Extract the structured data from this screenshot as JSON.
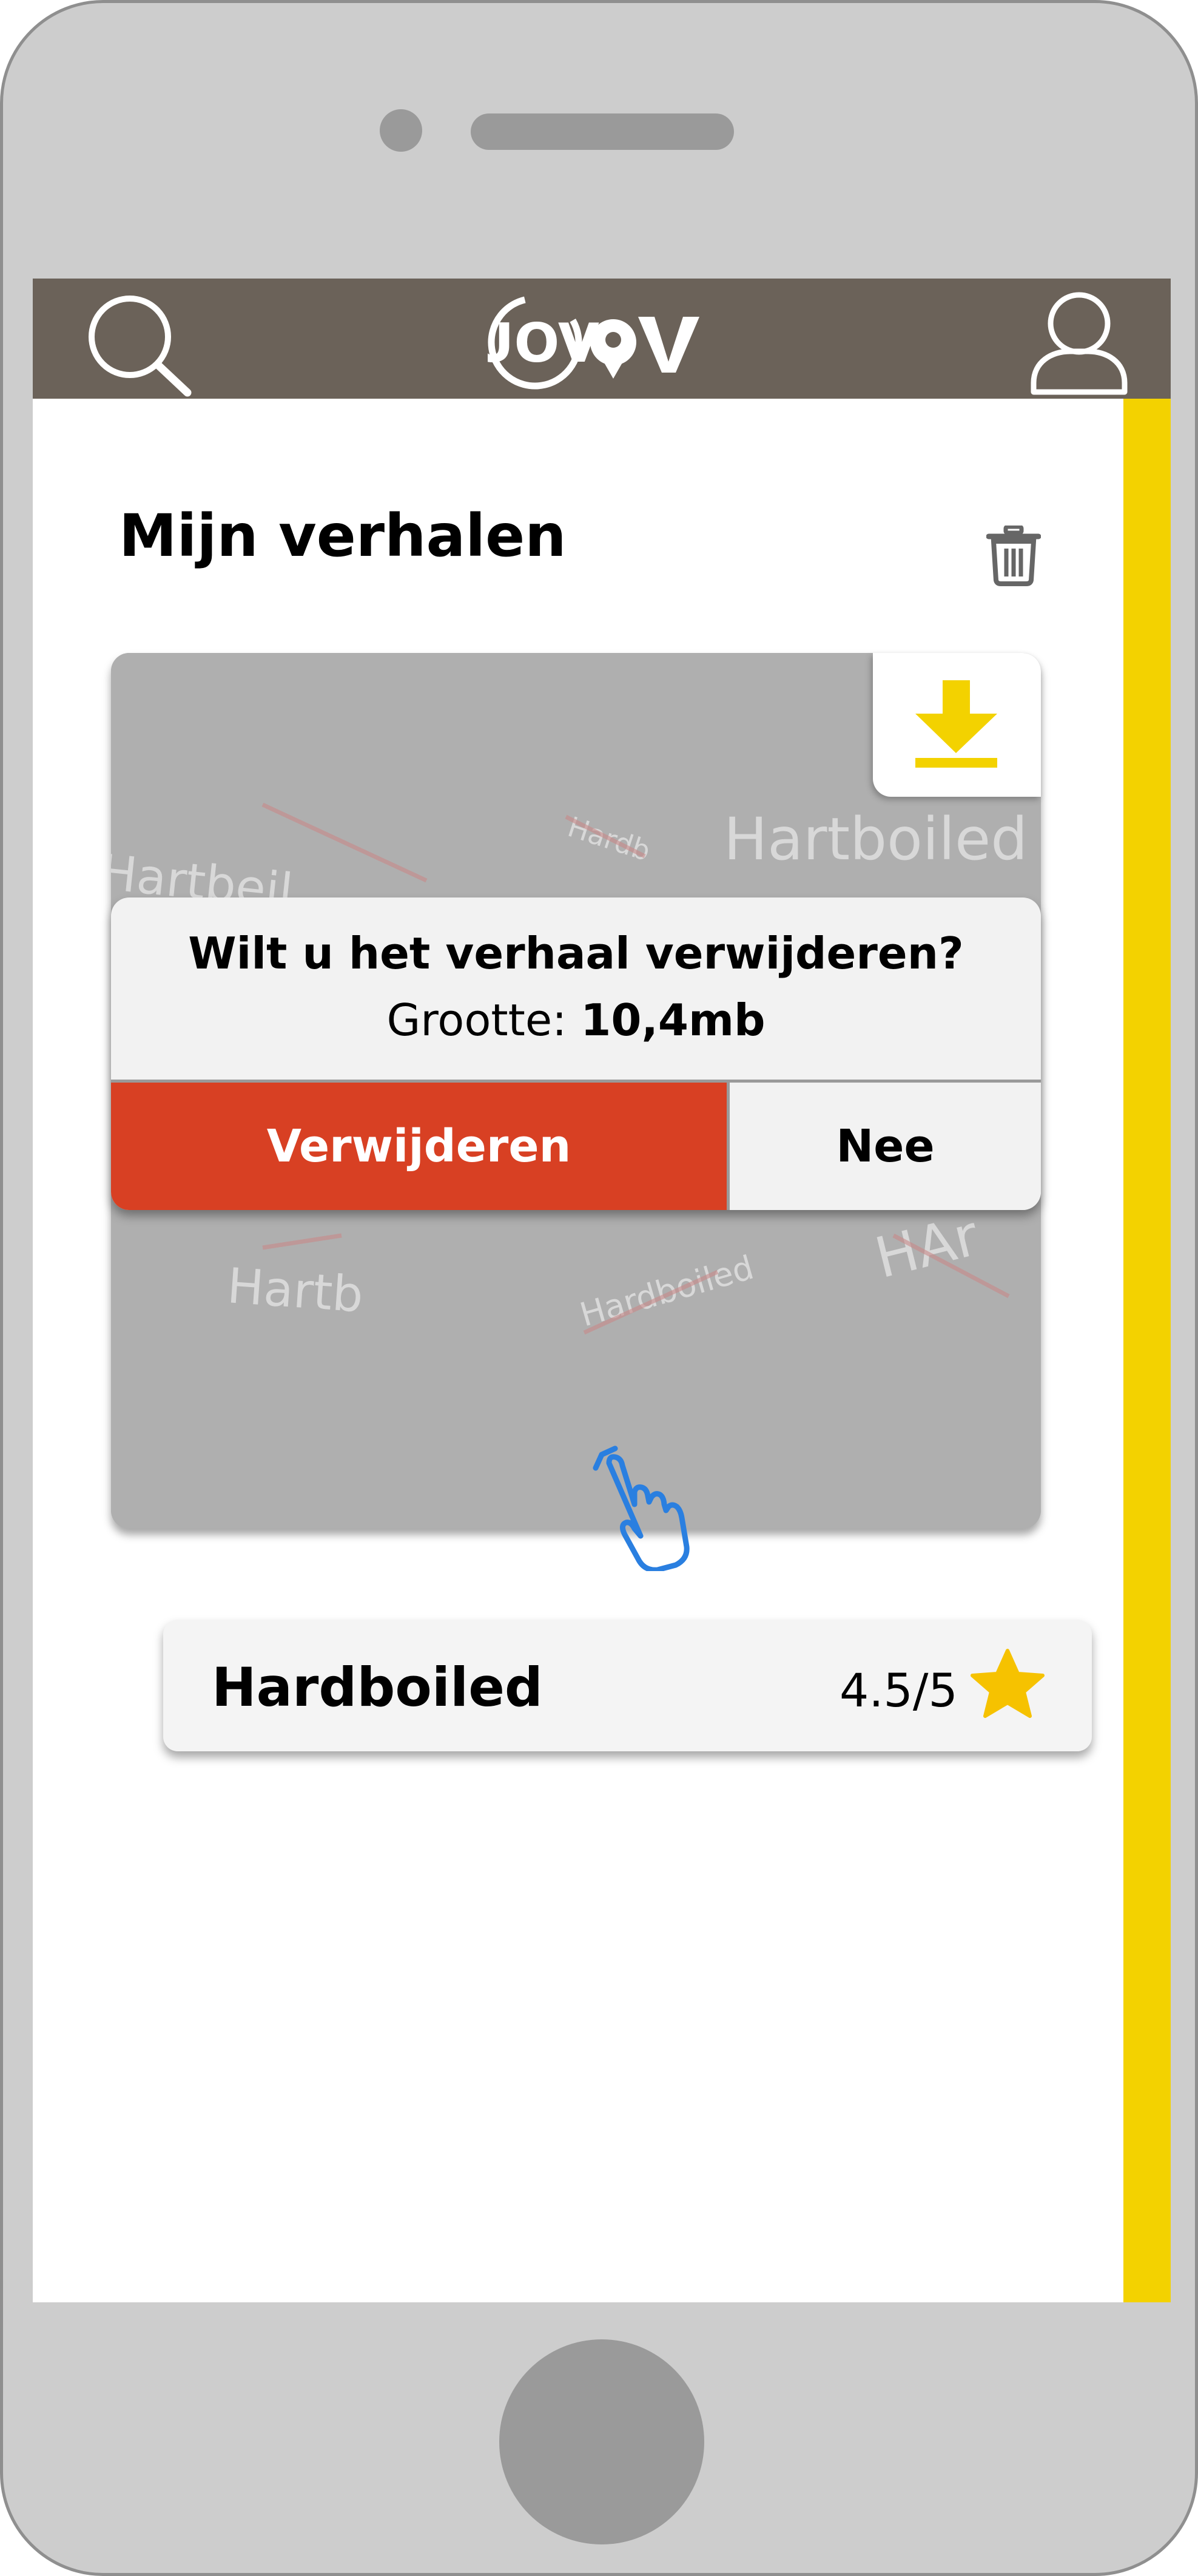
{
  "header": {
    "logo_text": "UOV",
    "search_icon": "search-icon",
    "profile_icon": "user-icon"
  },
  "page": {
    "title": "Mijn verhalen",
    "delete_icon": "trash-icon"
  },
  "story_card": {
    "download_icon": "download-icon",
    "background_text": [
      "Hartboiled",
      "Hartbeil",
      "Hardb",
      "Hartb",
      "HAr",
      "Hardboiled"
    ],
    "title": "Hardboiled",
    "rating": "4.5/5",
    "rating_icon": "star-icon"
  },
  "dialog": {
    "question": "Wilt u het verhaal verwijderen?",
    "size_label": "Grootte:",
    "size_value": "10,4mb",
    "confirm_label": "Verwijderen",
    "cancel_label": "Nee"
  },
  "cursor_icon": "hand-pointer-icon",
  "colors": {
    "header_bg": "#6b6259",
    "accent_yellow": "#f3d200",
    "delete_red": "#d84023",
    "star": "#f6c200",
    "cursor_blue": "#2a7fe0"
  }
}
